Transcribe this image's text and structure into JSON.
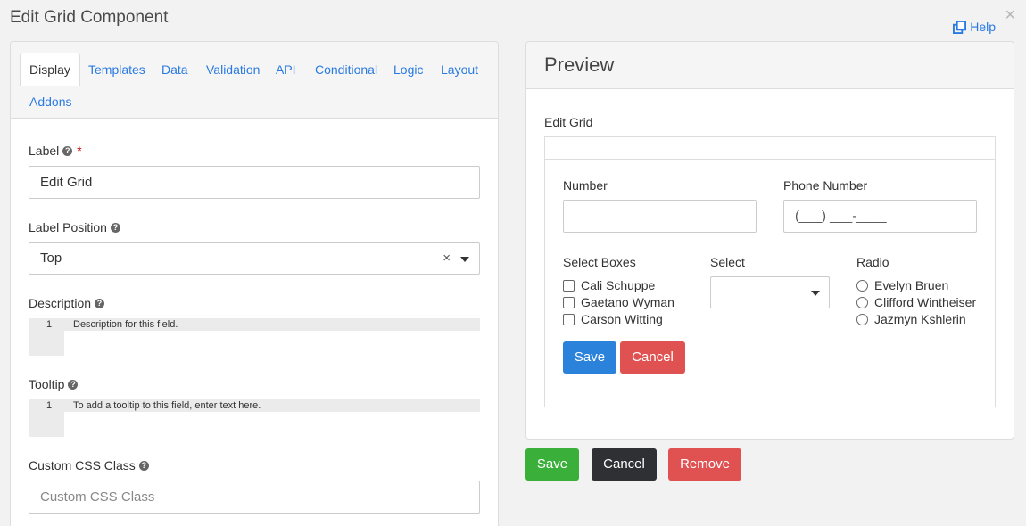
{
  "dialog": {
    "title": "Edit Grid Component",
    "help_label": "Help",
    "close_glyph": "×"
  },
  "tabs": [
    {
      "label": "Display",
      "active": true
    },
    {
      "label": "Templates"
    },
    {
      "label": "Data"
    },
    {
      "label": "Validation"
    },
    {
      "label": "API"
    },
    {
      "label": "Conditional"
    },
    {
      "label": "Logic"
    },
    {
      "label": "Layout"
    },
    {
      "label": "Addons"
    }
  ],
  "form": {
    "label": {
      "label": "Label",
      "required_mark": "*",
      "value": "Edit Grid"
    },
    "label_position": {
      "label": "Label Position",
      "value": "Top",
      "clear_glyph": "×"
    },
    "description": {
      "label": "Description",
      "line_number": "1",
      "placeholder": "Description for this field."
    },
    "tooltip": {
      "label": "Tooltip",
      "line_number": "1",
      "placeholder": "To add a tooltip to this field, enter text here."
    },
    "custom_css": {
      "label": "Custom CSS Class",
      "placeholder": "Custom CSS Class"
    }
  },
  "preview": {
    "title": "Preview",
    "edit_grid_label": "Edit Grid",
    "number_label": "Number",
    "phone_label": "Phone Number",
    "phone_mask": "(___) ___-____",
    "select_boxes_label": "Select Boxes",
    "select_boxes": [
      "Cali Schuppe",
      "Gaetano Wyman",
      "Carson Witting"
    ],
    "select_label": "Select",
    "radio_label": "Radio",
    "radio_options": [
      "Evelyn Bruen",
      "Clifford Wintheiser",
      "Jazmyn Kshlerin"
    ],
    "save_label": "Save",
    "cancel_label": "Cancel"
  },
  "footer": {
    "save_label": "Save",
    "cancel_label": "Cancel",
    "remove_label": "Remove"
  },
  "colors": {
    "link": "#2a7ae2",
    "primary": "#2a82da",
    "danger": "#e05252",
    "success": "#3aaf3a",
    "dark": "#2e3033"
  }
}
